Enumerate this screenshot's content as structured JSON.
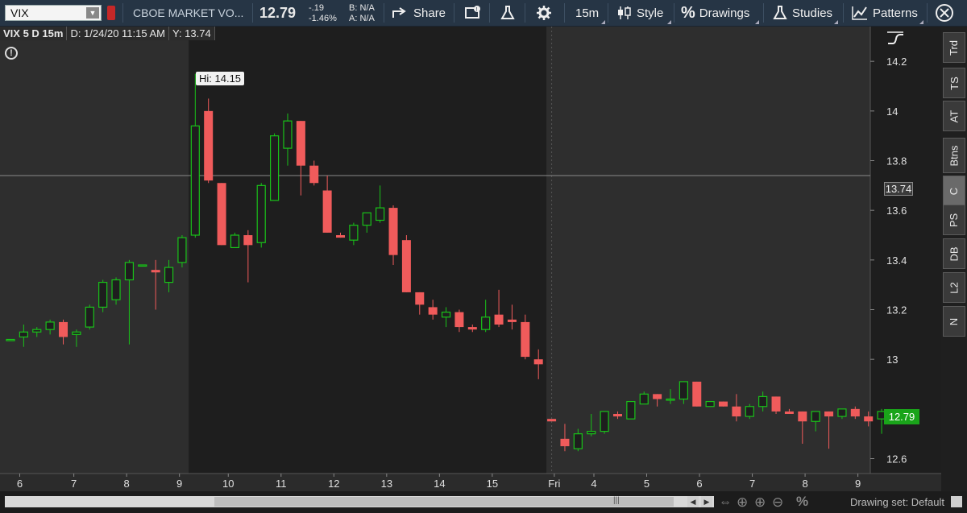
{
  "toolbar": {
    "symbol": "VIX",
    "description": "CBOE MARKET VO...",
    "last": "12.79",
    "net_change": "-.19",
    "pct_change": "-1.46%",
    "bid": "B: N/A",
    "ask": "A: N/A",
    "share_label": "Share",
    "timeframe_label": "15m",
    "style_label": "Style",
    "drawings_label": "Drawings",
    "studies_label": "Studies",
    "patterns_label": "Patterns"
  },
  "chart_header": {
    "symbol_info": "VIX 5 D 15m",
    "cursor_date": "D: 1/24/20 11:15 AM",
    "cursor_y": "Y: 13.74"
  },
  "side_tabs": [
    "Trd",
    "TS",
    "AT",
    "Btns",
    "C",
    "PS",
    "DB",
    "L2",
    "N"
  ],
  "footer": {
    "drawing_set": "Drawing set: Default"
  },
  "colors": {
    "up": "#19c219",
    "down": "#f05b5b",
    "price_tag": "#1aa41a",
    "cursor_tag": "#3a3a3a"
  },
  "chart_data": {
    "type": "candlestick",
    "ylim": [
      12.54,
      14.34
    ],
    "y_ticks": [
      "14.2",
      "14",
      "13.8",
      "13.6",
      "13.4",
      "13.2",
      "13",
      "12.6"
    ],
    "x_ticks": [
      "6",
      "7",
      "8",
      "9",
      "10",
      "11",
      "12",
      "13",
      "14",
      "15",
      "Fri",
      "4",
      "5",
      "6",
      "7",
      "8",
      "9"
    ],
    "hi_label": "Hi: 14.15",
    "crosshair_value": "13.74",
    "last_price_label": "12.79",
    "ohlc": [
      [
        13.08,
        13.08,
        13.08,
        13.08
      ],
      [
        13.09,
        13.14,
        13.05,
        13.11
      ],
      [
        13.11,
        13.13,
        13.09,
        13.12
      ],
      [
        13.12,
        13.16,
        13.1,
        13.15
      ],
      [
        13.15,
        13.16,
        13.06,
        13.09
      ],
      [
        13.1,
        13.12,
        13.05,
        13.11
      ],
      [
        13.13,
        13.22,
        13.12,
        13.21
      ],
      [
        13.21,
        13.32,
        13.19,
        13.31
      ],
      [
        13.24,
        13.33,
        13.22,
        13.32
      ],
      [
        13.32,
        13.4,
        13.06,
        13.39
      ],
      [
        13.38,
        13.38,
        13.38,
        13.38
      ],
      [
        13.36,
        13.4,
        13.2,
        13.35
      ],
      [
        13.31,
        13.4,
        13.27,
        13.37
      ],
      [
        13.39,
        13.5,
        13.37,
        13.49
      ],
      [
        13.5,
        14.15,
        13.49,
        13.94
      ],
      [
        14.0,
        14.05,
        13.71,
        13.72
      ],
      [
        13.71,
        13.71,
        13.46,
        13.46
      ],
      [
        13.45,
        13.51,
        13.45,
        13.5
      ],
      [
        13.5,
        13.52,
        13.31,
        13.46
      ],
      [
        13.47,
        13.71,
        13.45,
        13.7
      ],
      [
        13.64,
        13.91,
        13.64,
        13.9
      ],
      [
        13.85,
        13.99,
        13.78,
        13.96
      ],
      [
        13.96,
        13.96,
        13.66,
        13.78
      ],
      [
        13.78,
        13.8,
        13.7,
        13.71
      ],
      [
        13.68,
        13.74,
        13.51,
        13.51
      ],
      [
        13.5,
        13.51,
        13.49,
        13.49
      ],
      [
        13.48,
        13.55,
        13.46,
        13.54
      ],
      [
        13.54,
        13.59,
        13.51,
        13.59
      ],
      [
        13.56,
        13.7,
        13.55,
        13.61
      ],
      [
        13.61,
        13.62,
        13.38,
        13.42
      ],
      [
        13.48,
        13.5,
        13.27,
        13.27
      ],
      [
        13.27,
        13.27,
        13.18,
        13.22
      ],
      [
        13.21,
        13.24,
        13.16,
        13.18
      ],
      [
        13.17,
        13.21,
        13.13,
        13.19
      ],
      [
        13.19,
        13.2,
        13.11,
        13.13
      ],
      [
        13.13,
        13.14,
        13.11,
        13.12
      ],
      [
        13.12,
        13.24,
        13.11,
        13.17
      ],
      [
        13.18,
        13.28,
        13.13,
        13.14
      ],
      [
        13.16,
        13.22,
        13.12,
        13.15
      ],
      [
        13.15,
        13.18,
        13.0,
        13.01
      ],
      [
        13.0,
        13.04,
        12.92,
        12.98
      ],
      [
        12.76,
        12.76,
        12.76,
        12.75
      ],
      [
        12.68,
        12.74,
        12.63,
        12.65
      ],
      [
        12.64,
        12.72,
        12.63,
        12.7
      ],
      [
        12.7,
        12.78,
        12.69,
        12.71
      ],
      [
        12.71,
        12.79,
        12.7,
        12.79
      ],
      [
        12.78,
        12.79,
        12.76,
        12.77
      ],
      [
        12.76,
        12.83,
        12.76,
        12.83
      ],
      [
        12.82,
        12.87,
        12.82,
        12.86
      ],
      [
        12.86,
        12.86,
        12.81,
        12.84
      ],
      [
        12.84,
        12.88,
        12.82,
        12.84
      ],
      [
        12.84,
        12.91,
        12.82,
        12.91
      ],
      [
        12.91,
        12.91,
        12.81,
        12.81
      ],
      [
        12.81,
        12.83,
        12.81,
        12.83
      ],
      [
        12.83,
        12.83,
        12.81,
        12.81
      ],
      [
        12.81,
        12.86,
        12.75,
        12.77
      ],
      [
        12.77,
        12.82,
        12.76,
        12.81
      ],
      [
        12.81,
        12.87,
        12.79,
        12.85
      ],
      [
        12.85,
        12.85,
        12.78,
        12.79
      ],
      [
        12.79,
        12.8,
        12.78,
        12.78
      ],
      [
        12.79,
        12.79,
        12.66,
        12.75
      ],
      [
        12.75,
        12.79,
        12.71,
        12.79
      ],
      [
        12.79,
        12.79,
        12.64,
        12.77
      ],
      [
        12.77,
        12.8,
        12.76,
        12.8
      ],
      [
        12.8,
        12.81,
        12.76,
        12.77
      ],
      [
        12.77,
        12.79,
        12.73,
        12.75
      ],
      [
        12.76,
        12.8,
        12.7,
        12.79
      ]
    ]
  }
}
